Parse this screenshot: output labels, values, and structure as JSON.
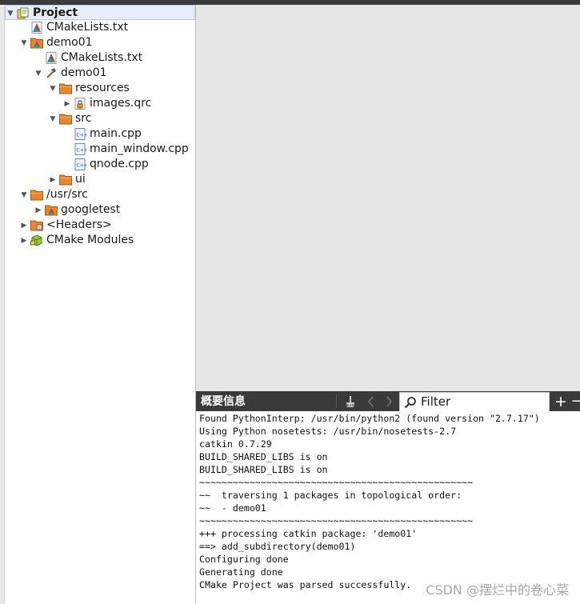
{
  "project_tree": {
    "rows": [
      {
        "label": "Project",
        "icon": "project-icon",
        "arrow": "expanded",
        "bold": true
      },
      {
        "label": "CMakeLists.txt",
        "icon": "cmake-file-icon",
        "arrow": "none"
      },
      {
        "label": "demo01",
        "icon": "cmake-project-icon",
        "arrow": "expanded"
      },
      {
        "label": "CMakeLists.txt",
        "icon": "cmake-file-icon",
        "arrow": "none"
      },
      {
        "label": "demo01",
        "icon": "hammer-icon",
        "arrow": "expanded"
      },
      {
        "label": "resources",
        "icon": "folder-icon",
        "arrow": "expanded"
      },
      {
        "label": "images.qrc",
        "icon": "locked-resource-icon",
        "arrow": "collapsed"
      },
      {
        "label": "src",
        "icon": "folder-icon",
        "arrow": "expanded"
      },
      {
        "label": "main.cpp",
        "icon": "cpp-file-icon",
        "arrow": "none"
      },
      {
        "label": "main_window.cpp",
        "icon": "cpp-file-icon",
        "arrow": "none"
      },
      {
        "label": "qnode.cpp",
        "icon": "cpp-file-icon",
        "arrow": "none"
      },
      {
        "label": "ui",
        "icon": "folder-icon",
        "arrow": "collapsed"
      },
      {
        "label": "/usr/src",
        "icon": "folder-icon",
        "arrow": "expanded"
      },
      {
        "label": "googletest",
        "icon": "cmake-project-icon",
        "arrow": "collapsed"
      },
      {
        "label": "<Headers>",
        "icon": "headers-folder-icon",
        "arrow": "collapsed"
      },
      {
        "label": "CMake Modules",
        "icon": "cmake-modules-icon",
        "arrow": "collapsed"
      }
    ]
  },
  "output_pane": {
    "title": "概要信息",
    "filter_label": "Filter",
    "add_label": "+",
    "minus_label": "−",
    "lines": [
      "Found PythonInterp: /usr/bin/python2 (found version \"2.7.17\")",
      "Using Python nosetests: /usr/bin/nosetests-2.7",
      "catkin 0.7.29",
      "BUILD_SHARED_LIBS is on",
      "BUILD_SHARED_LIBS is on",
      "~~~~~~~~~~~~~~~~~~~~~~~~~~~~~~~~~~~~~~~~~~~~~~~~~",
      "~~  traversing 1 packages in topological order:",
      "~~  - demo01",
      "~~~~~~~~~~~~~~~~~~~~~~~~~~~~~~~~~~~~~~~~~~~~~~~~~",
      "+++ processing catkin package: 'demo01'",
      "==> add_subdirectory(demo01)",
      "Configuring done",
      "Generating done",
      "CMake Project was parsed successfully."
    ]
  },
  "watermark": "CSDN @摆烂中的卷心菜",
  "colors": {
    "toolbar_bg": "#3a3a3a",
    "editor_bg": "#e6e6e6",
    "folder": "#e8862e",
    "selection": "#e8eef8"
  }
}
